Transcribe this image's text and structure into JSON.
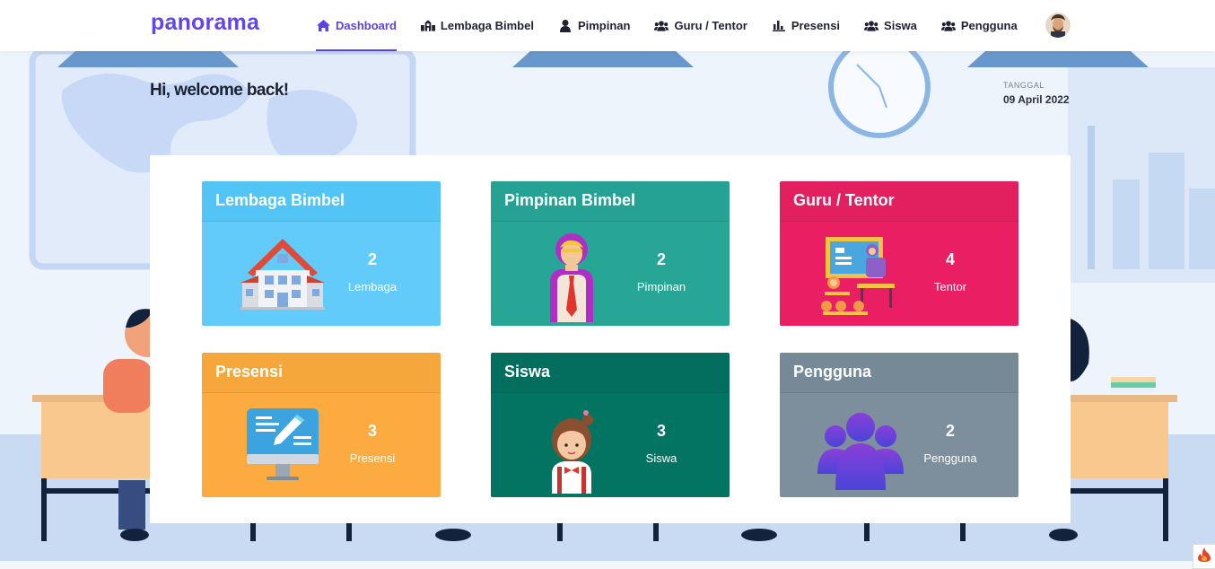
{
  "brand": "panorama",
  "nav": {
    "items": [
      {
        "label": "Dashboard",
        "icon": "home-icon",
        "active": true
      },
      {
        "label": "Lembaga Bimbel",
        "icon": "building-icon",
        "active": false
      },
      {
        "label": "Pimpinan",
        "icon": "user-icon",
        "active": false
      },
      {
        "label": "Guru / Tentor",
        "icon": "users-icon",
        "active": false
      },
      {
        "label": "Presensi",
        "icon": "chart-icon",
        "active": false
      },
      {
        "label": "Siswa",
        "icon": "users-icon",
        "active": false
      },
      {
        "label": "Pengguna",
        "icon": "users-icon",
        "active": false
      }
    ]
  },
  "welcome": "Hi, welcome back!",
  "date": {
    "label": "TANGGAL",
    "value": "09 April 2022"
  },
  "cards": [
    {
      "title": "Lembaga Bimbel",
      "count": "2",
      "unit": "Lembaga",
      "head_color": "#52c4f5",
      "body_color": "#63cbf9",
      "illustration": "school-building"
    },
    {
      "title": "Pimpinan Bimbel",
      "count": "2",
      "unit": "Pimpinan",
      "head_color": "#25a293",
      "body_color": "#27a696",
      "illustration": "leader-woman"
    },
    {
      "title": "Guru / Tentor",
      "count": "4",
      "unit": "Tentor",
      "head_color": "#e21f5f",
      "body_color": "#ea1f63",
      "illustration": "teacher-classroom"
    },
    {
      "title": "Presensi",
      "count": "3",
      "unit": "Presensi",
      "head_color": "#f6a73b",
      "body_color": "#fbab40",
      "illustration": "monitor-form"
    },
    {
      "title": "Siswa",
      "count": "3",
      "unit": "Siswa",
      "head_color": "#046e5e",
      "body_color": "#047462",
      "illustration": "student-girl"
    },
    {
      "title": "Pengguna",
      "count": "2",
      "unit": "Pengguna",
      "head_color": "#758997",
      "body_color": "#7d8f9c",
      "illustration": "users-group"
    }
  ]
}
